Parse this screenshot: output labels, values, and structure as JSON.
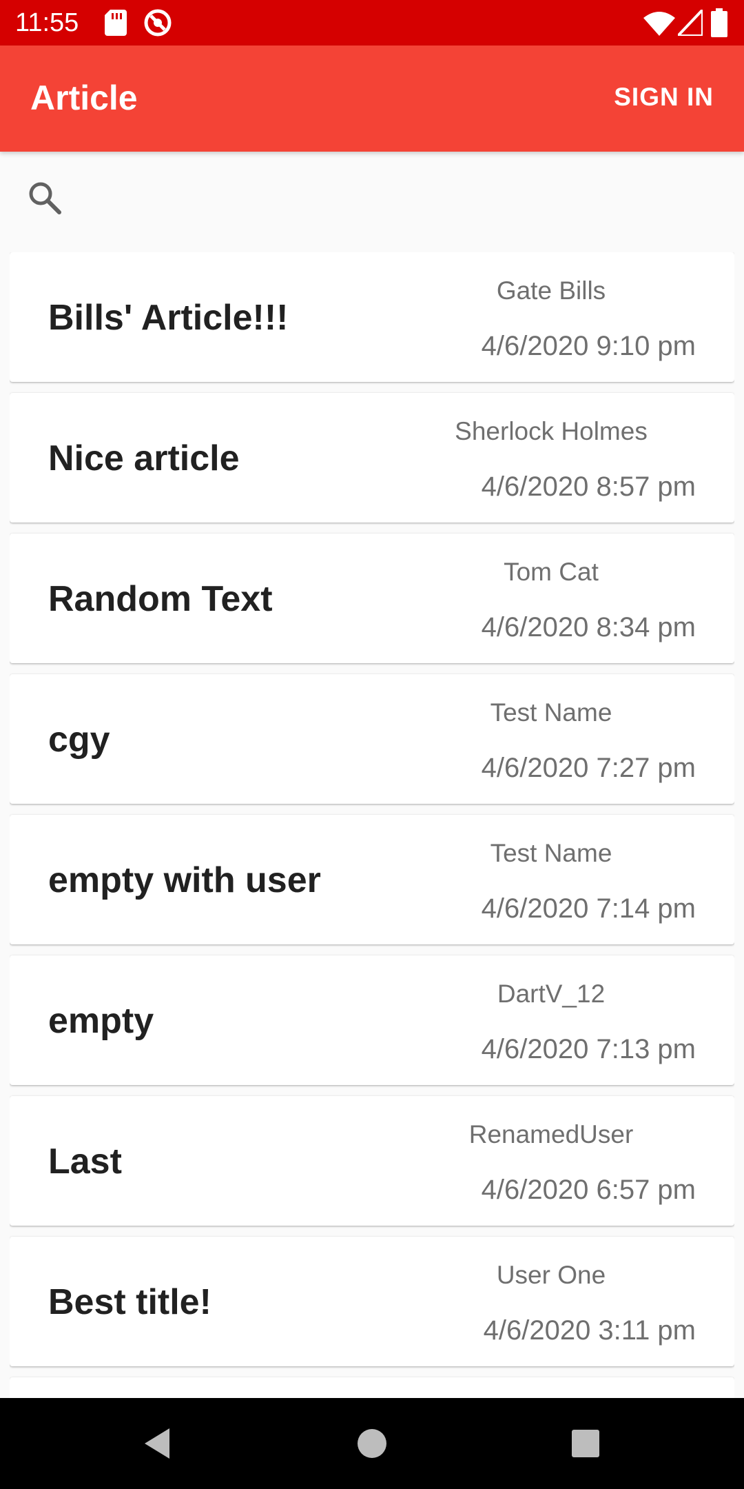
{
  "status_bar": {
    "time": "11:55",
    "icons": [
      "sd-card-icon",
      "do-not-disturb-icon",
      "wifi-icon",
      "signal-icon",
      "battery-icon"
    ]
  },
  "app_bar": {
    "title": "Article",
    "signin_label": "SIGN IN",
    "background": "#F44336"
  },
  "search": {
    "icon": "search-icon"
  },
  "articles": [
    {
      "title": "Bills' Article!!!",
      "author": "Gate Bills",
      "date": "4/6/2020 9:10 pm"
    },
    {
      "title": "Nice article",
      "author": "Sherlock Holmes",
      "date": "4/6/2020 8:57 pm"
    },
    {
      "title": "Random Text",
      "author": "Tom Cat",
      "date": "4/6/2020 8:34 pm"
    },
    {
      "title": "cgy",
      "author": "Test Name",
      "date": "4/6/2020 7:27 pm"
    },
    {
      "title": "empty with user",
      "author": "Test Name",
      "date": "4/6/2020 7:14 pm"
    },
    {
      "title": "empty",
      "author": "DartV_12",
      "date": "4/6/2020 7:13 pm"
    },
    {
      "title": "Last",
      "author": "RenamedUser",
      "date": "4/6/2020 6:57 pm"
    },
    {
      "title": "Best title!",
      "author": "User One",
      "date": "4/6/2020 3:11 pm"
    }
  ],
  "nav": {
    "icons": [
      "back-icon",
      "home-icon",
      "recents-icon"
    ]
  }
}
